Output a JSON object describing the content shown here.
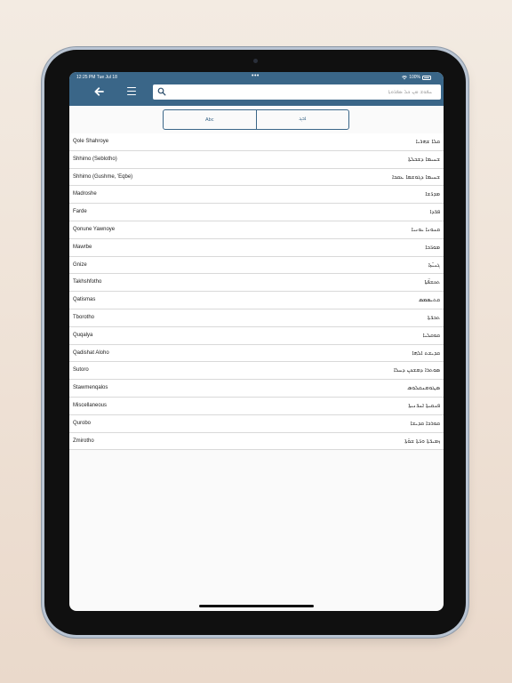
{
  "status": {
    "time": "12:25 PM   Tue Jul 18",
    "dots": "•••",
    "battery": "100%"
  },
  "search": {
    "placeholder": "ܚܦܘܫ ܡܢ ܟܠ ܣܦܪܘܬܐ"
  },
  "segments": [
    {
      "label": "Abc"
    },
    {
      "label": "ܐܒܓ"
    }
  ],
  "categories": [
    {
      "en": "Qole Shahroye",
      "syr": "ܩܠܐ ܫܗܪܝܐ"
    },
    {
      "en": "Shhimo (Seblotho)",
      "syr": "ܫܚܝܡܐ ܕܫܒܠܬܐ"
    },
    {
      "en": "Shhimo (Gushme, 'Eqbe)",
      "syr": "ܫܚܝܡܐ ܕܓܘܫܡܐ ܥܩܒܐ"
    },
    {
      "en": "Madroshe",
      "syr": "ܡܕܪ̈ܫܐ"
    },
    {
      "en": "Farde",
      "syr": "ܦܪ̈ܕܐ"
    },
    {
      "en": "Qonune Yawnoye",
      "syr": "ܩܢܘܢܐ ܝܘܢܝܐ"
    },
    {
      "en": "Mawrbe",
      "syr": "ܡܘܪ̈ܒܐ"
    },
    {
      "en": "Gnize",
      "syr": "ܓܢܝ̈ܙܐ"
    },
    {
      "en": "Takhshfotho",
      "syr": "ܬܟܫܦ̈ܬܐ"
    },
    {
      "en": "Qatismas",
      "syr": "ܩܬܝܣܡܣ"
    },
    {
      "en": "Tborotho",
      "syr": "ܬܒܪ̈ܬܐ"
    },
    {
      "en": "Quqalya",
      "syr": "ܩܘܩܠܝܐ"
    },
    {
      "en": "Qadishat Aloho",
      "syr": "ܩܕܝܫܬ ܐܠܗܐ"
    },
    {
      "en": "Sutoro",
      "syr": "ܣܘܬܪܐ ܕܡܫܟܢ ܕܚܠܐ"
    },
    {
      "en": "Stawmenqalos",
      "syr": "ܣܛܘܡܢܩܠܘܣ"
    },
    {
      "en": "Miscellaneous",
      "syr": "ܦܢܩܝܬܐ ܐܚܪ̈ܢܝܬܐ"
    },
    {
      "en": "Qurobo",
      "syr": "ܩܘܪܒܐ ܩܕܝܫܐ"
    },
    {
      "en": "Zmirotho",
      "syr": "ܙܡܝܪ̈ܬܐ ܘܪ̈ܬܐ ܫܘ̈ܬܐ"
    }
  ],
  "colors": {
    "header": "#3a6688",
    "accent": "#3a6688"
  }
}
